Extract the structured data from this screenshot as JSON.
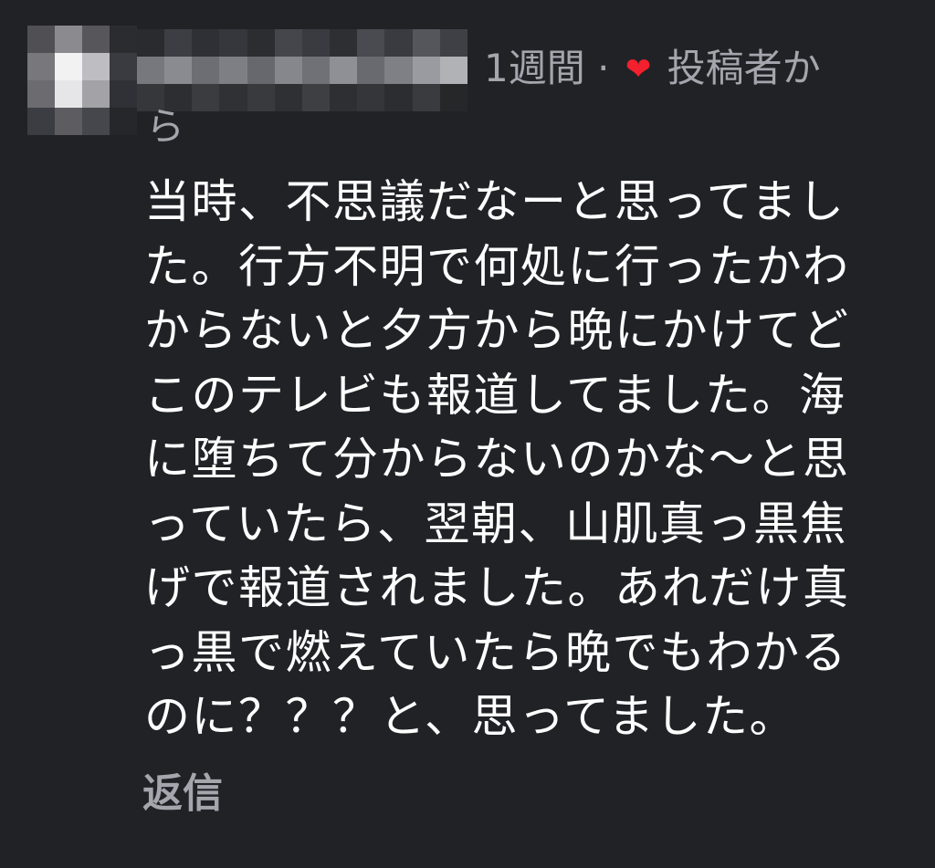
{
  "comment": {
    "timestamp": "1週間",
    "separator": "·",
    "heart_color": "#f3202e",
    "author_reaction_label": "投稿者か",
    "author_reaction_label_cont": "ら",
    "body_lines": [
      "当時、不思議だなーと思ってまし",
      "た。行方不明で何処に行ったかわ",
      "からないと夕方から晩にかけてど",
      "このテレビも報道してました。海",
      "に堕ちて分からないのかな〜と思",
      "っていたら、翌朝、山肌真っ黒焦",
      "げで報道されました。あれだけ真",
      "っ黒で燃えていたら晩でもわかる",
      "のに？？？と、思ってました。"
    ],
    "reply_label": "返信"
  },
  "colors": {
    "background": "#212226",
    "text": "#ffffff",
    "muted": "#a4a6ad"
  }
}
